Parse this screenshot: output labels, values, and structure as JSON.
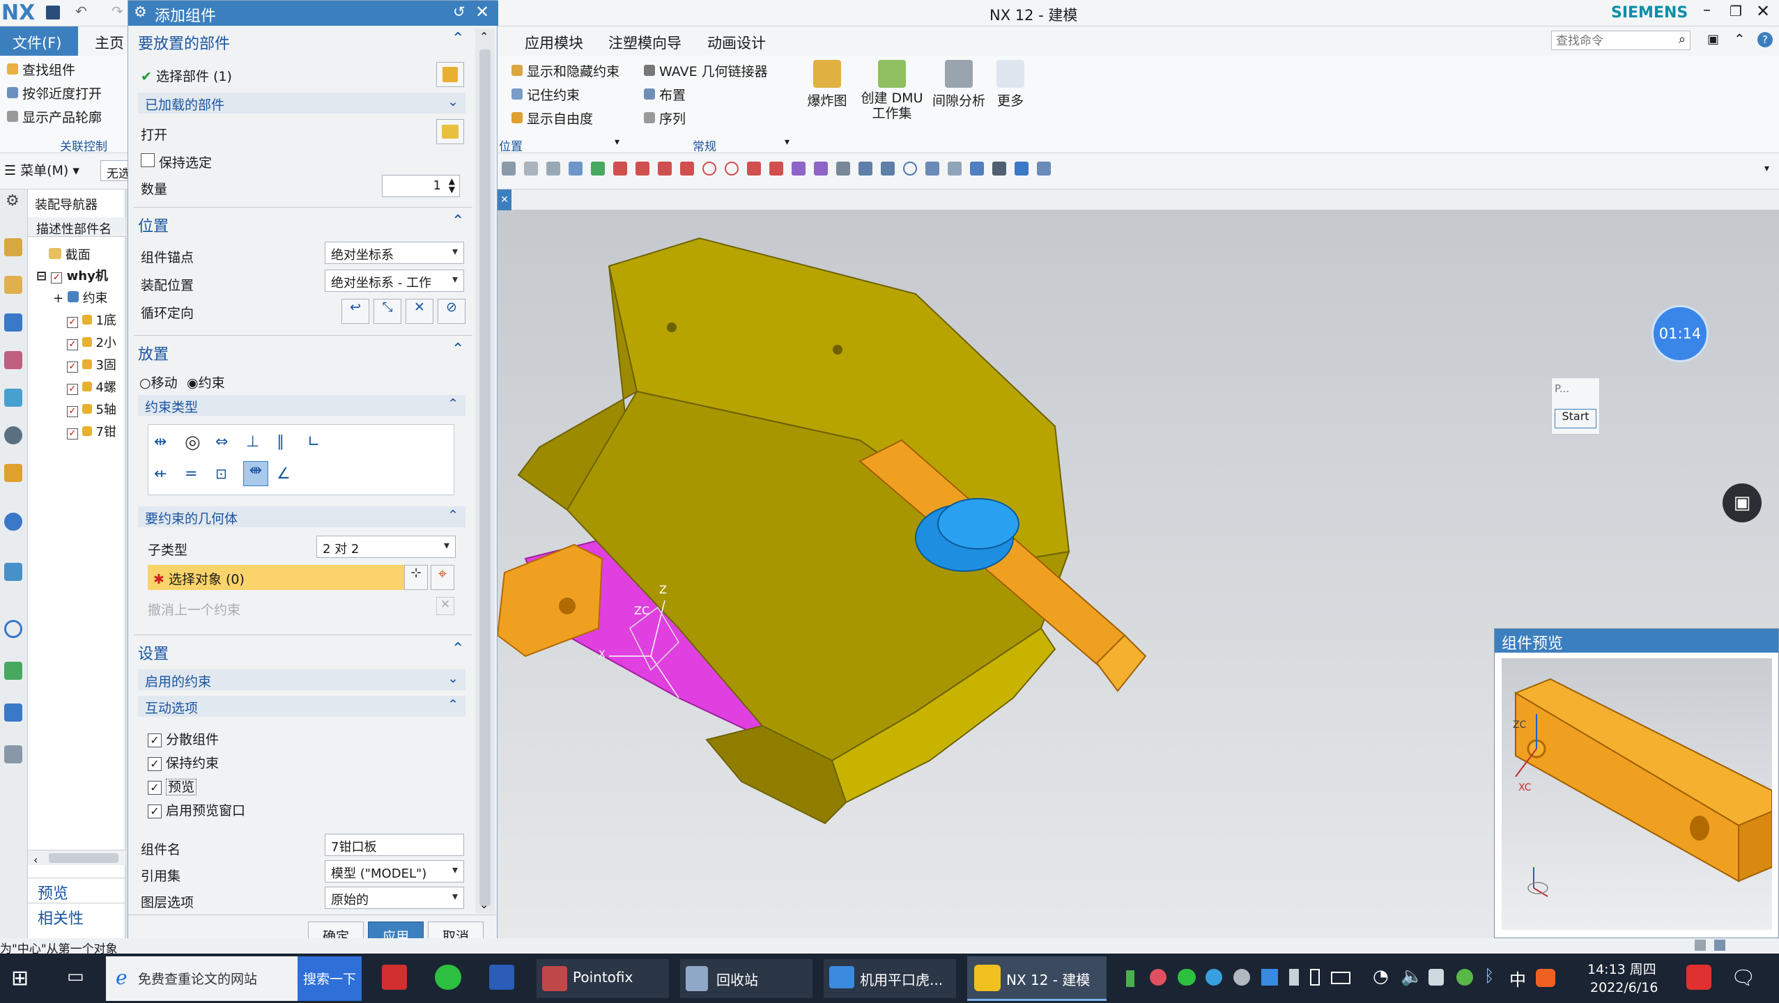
{
  "app": {
    "logo": "NX",
    "window_title": "NX 12 - 建模",
    "brand": "SIEMENS",
    "search_placeholder": "查找命令"
  },
  "menubar": {
    "file": "文件(F)",
    "home": "主页",
    "tabs": [
      "应用模块",
      "注塑模向导",
      "动画设计"
    ]
  },
  "ribbon": {
    "left_items": [
      "查找组件",
      "按邻近度打开",
      "显示产品轮廓"
    ],
    "left_group": "关联控制",
    "group1_items": [
      "显示和隐藏约束",
      "记住约束",
      "显示自由度"
    ],
    "group1_label": "位置",
    "group2_items": [
      "WAVE 几何链接器",
      "布置",
      "序列"
    ],
    "group2_label": "常规",
    "big_buttons": [
      "爆炸图",
      "创建 DMU 工作集",
      "间隙分析",
      "更多"
    ]
  },
  "quickbar": {
    "menu": "菜单(M)",
    "filter": "无选"
  },
  "navigator": {
    "title": "装配导航器",
    "column": "描述性部件名",
    "items": [
      "截面",
      "why机",
      "约束",
      "1底",
      "2小",
      "3固",
      "4螺",
      "5轴",
      "7钳"
    ],
    "bottom": [
      "预览",
      "相关性"
    ]
  },
  "dialog": {
    "title": "添加组件",
    "sec_parts": "要放置的部件",
    "select_part": "选择部件 (1)",
    "loaded_parts": "已加载的部件",
    "open": "打开",
    "keep_selected": "保持选定",
    "quantity_label": "数量",
    "quantity": "1",
    "sec_position": "位置",
    "anchor_label": "组件锚点",
    "anchor_value": "绝对坐标系",
    "assembly_pos_label": "装配位置",
    "assembly_pos_value": "绝对坐标系 - 工作",
    "cycle_label": "循环定向",
    "sec_placement": "放置",
    "move": "移动",
    "constraint": "约束",
    "constraint_type": "约束类型",
    "geom_title": "要约束的几何体",
    "subtype_label": "子类型",
    "subtype_value": "2 对 2",
    "select_object": "选择对象 (0)",
    "undo_last": "撤消上一个约束",
    "sec_settings": "设置",
    "enabled_constraints": "启用的约束",
    "interaction_options": "互动选项",
    "opt_scatter": "分散组件",
    "opt_keep_constraints": "保持约束",
    "opt_preview": "预览",
    "opt_preview_window": "启用预览窗口",
    "comp_name_label": "组件名",
    "comp_name_value": "7钳口板",
    "ref_set_label": "引用集",
    "ref_set_value": "模型 (\"MODEL\")",
    "layer_label": "图层选项",
    "layer_value": "原始的",
    "ok": "确定",
    "apply": "应用",
    "cancel": "取消"
  },
  "viewport": {
    "timer": "01:14",
    "mini_label": "P...",
    "start": "Start",
    "preview_title": "组件预览",
    "axes": {
      "z": "Z",
      "zc": "ZC",
      "xc": "XC",
      "x": "X"
    }
  },
  "status": {
    "text": "为\"中心\"从第一个对象"
  },
  "taskbar": {
    "search_text": "免费查重论文的网站",
    "search_button": "搜索一下",
    "apps": [
      "Pointofix",
      "回收站",
      "机用平口虎...",
      "NX 12 - 建模"
    ],
    "ime": "中",
    "time": "14:13 周四",
    "date": "2022/6/16"
  },
  "colors": {
    "accent": "#3c7fbf",
    "part_yellow": "#b8a400",
    "part_orange": "#f0a020",
    "part_magenta": "#e040e0",
    "part_blue": "#1e8fe0"
  }
}
